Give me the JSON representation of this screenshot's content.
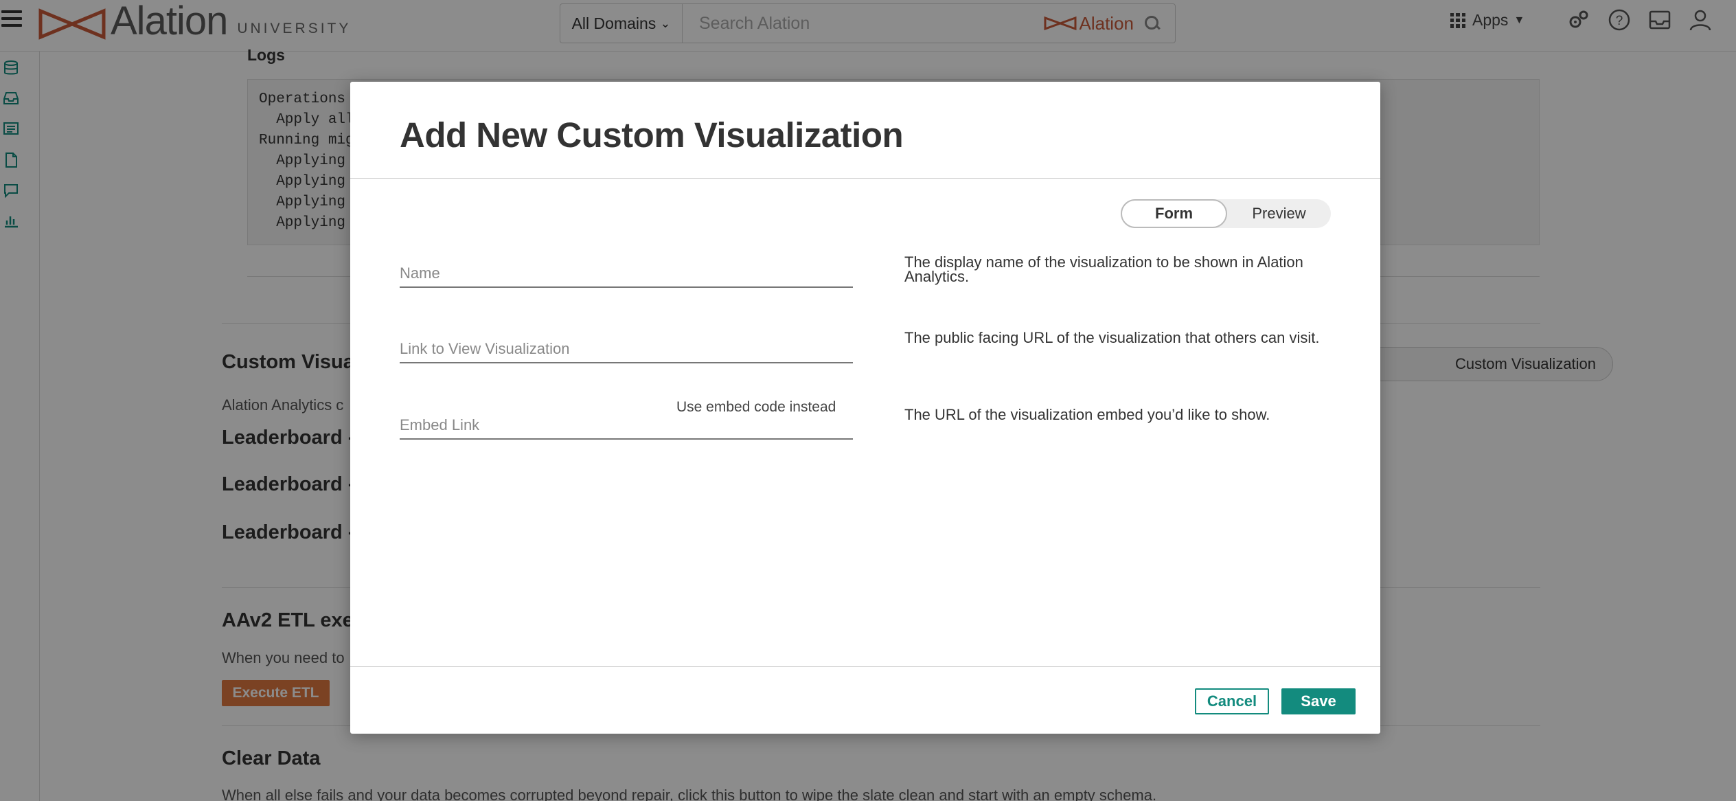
{
  "header": {
    "logo_name": "Alation",
    "logo_sub": "UNIVERSITY",
    "domain_selector": "All Domains",
    "search_placeholder": "Search Alation",
    "search_brand": "Alation",
    "apps_label": "Apps"
  },
  "background": {
    "logs_title": "Logs",
    "log_lines": [
      "Operations t",
      "  Apply all",
      "Running migr",
      "  Applying c",
      "  Applying c",
      "  Applying c",
      "  Applying c"
    ],
    "custom_vis_title": "Custom Visua",
    "custom_vis_desc": "Alation Analytics c",
    "add_vis_button": "Custom Visualization",
    "leaderboards": [
      "Leaderboard -",
      "Leaderboard -",
      "Leaderboard -"
    ],
    "etl_title": "AAv2 ETL exec",
    "etl_desc": "When you need to",
    "etl_button": "Execute ETL",
    "clear_title": "Clear Data",
    "clear_desc": "When all else fails and your data becomes corrupted beyond repair, click this button to wipe the slate clean and start with an empty schema."
  },
  "modal": {
    "title": "Add New Custom Visualization",
    "toggle": {
      "form": "Form",
      "preview": "Preview",
      "active": "Form"
    },
    "fields": {
      "name": {
        "placeholder": "Name",
        "value": "",
        "help": "The display name of the visualization to be shown in Alation Analytics."
      },
      "link": {
        "placeholder": "Link to View Visualization",
        "value": "",
        "help": "The public facing URL of the visualization that others can visit."
      },
      "embed": {
        "placeholder": "Embed Link",
        "value": "",
        "help": "The URL of the visualization embed you’d like to show.",
        "alt_link": "Use embed code instead"
      }
    },
    "cancel_label": "Cancel",
    "save_label": "Save"
  },
  "colors": {
    "accent": "#138b7e",
    "brand": "#c85a3a",
    "etl_button": "#e07840"
  }
}
